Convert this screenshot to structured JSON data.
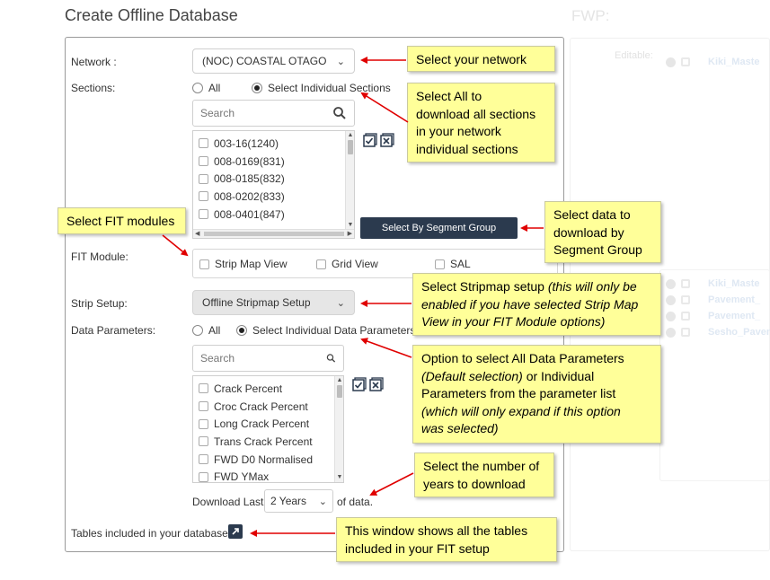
{
  "page": {
    "title": "Create Offline Database"
  },
  "form": {
    "network_label": "Network :",
    "network_value": "(NOC) COASTAL OTAGO",
    "sections_label": "Sections:",
    "sections_all": "All",
    "sections_individual": "Select Individual Sections",
    "search_placeholder": "Search",
    "section_items": [
      "003-16(1240)",
      "008-0169(831)",
      "008-0185(832)",
      "008-0202(833)",
      "008-0401(847)"
    ],
    "segment_group_button": "Select By Segment Group",
    "fit_module_label": "FIT Module:",
    "fit_modules": [
      "Strip Map View",
      "Grid View",
      "SAL"
    ],
    "strip_setup_label": "Strip Setup:",
    "strip_setup_value": "Offline Stripmap Setup",
    "data_params_label": "Data Parameters:",
    "data_params_all": "All",
    "data_params_individual": "Select Individual Data Parameters",
    "param_items": [
      "Crack Percent",
      "Croc Crack Percent",
      "Long Crack Percent",
      "Trans Crack Percent",
      "FWD D0 Normalised",
      "FWD YMax"
    ],
    "download_prefix": "Download Last",
    "download_years": "2 Years",
    "download_suffix": "of data.",
    "tables_label": "Tables included in your database:"
  },
  "callouts": {
    "network": "Select your network",
    "sections": [
      "Select All to",
      "download all sections",
      "in your network",
      "individual sections"
    ],
    "fit": "Select FIT modules",
    "segment": [
      "Select data to",
      "download by",
      "Segment Group"
    ],
    "stripmap_plain": "Select Stripmap setup ",
    "stripmap_italic": [
      "(this will only be",
      "enabled if you have selected Strip Map",
      "View in your FIT Module options)"
    ],
    "params_plain": [
      "Option to select All Data Parameters",
      "or Individual",
      "Parameters from the parameter list"
    ],
    "params_italic": [
      "(Default selection)",
      "(which will only expand if this option",
      "was selected)"
    ],
    "years": [
      "Select the number of",
      "years to download"
    ],
    "tables": [
      "This window shows all the tables",
      "included in your FIT setup"
    ]
  },
  "right_panel": {
    "title": "FWP:",
    "editable_label": "Editable:",
    "items_top": [
      "Kiki_Maste"
    ],
    "items_lower": [
      "Kiki_Maste",
      "Pavement_",
      "Pavement_",
      "Sesho_Pavem"
    ]
  },
  "colors": {
    "note_bg": "#ffff99",
    "arrow": "#e00000",
    "button_dark": "#2b3a4e"
  },
  "icons": [
    "chevron-down-icon",
    "search-icon",
    "select-all-icon",
    "deselect-all-icon",
    "external-link-icon",
    "info-icon",
    "lock-icon"
  ]
}
